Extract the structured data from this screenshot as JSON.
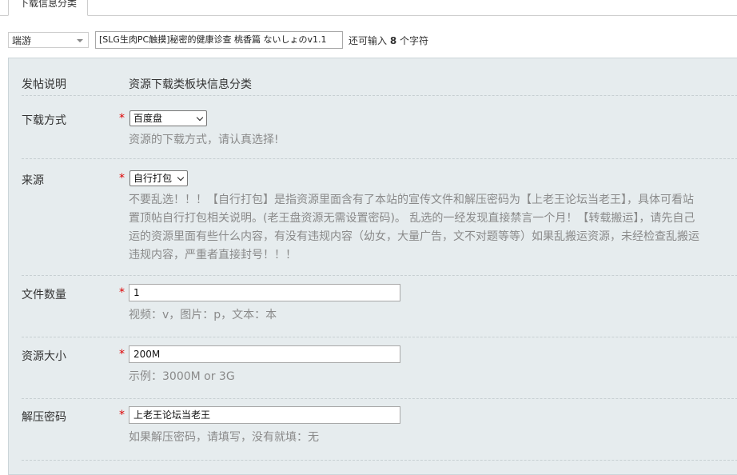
{
  "tabs": [
    {
      "label": "下载信息分类"
    }
  ],
  "subject": {
    "type_select": "端游",
    "title_value": "[SLG生肉PC触摸]秘密的健康诊查 桃香篇 ないしょのv1.1",
    "remaining_prefix": "还可输入",
    "remaining_count": "8",
    "remaining_suffix": "个字符"
  },
  "form": {
    "intro": {
      "label": "发帖说明",
      "value": "资源下载类板块信息分类"
    },
    "download_method": {
      "label": "下载方式",
      "required": "*",
      "selected": "百度盘",
      "hint": "资源的下载方式，请认真选择!"
    },
    "source": {
      "label": "来源",
      "required": "*",
      "selected": "自行打包",
      "hint_lines": [
        "不要乱选！！！【自行打包】是指资源里面含有了本站的宣传文件和解压密码为【上老王论坛当老王】，具体可看站",
        "置顶帖自行打包相关说明。(老王盘资源无需设置密码)。 乱选的一经发现直接禁言一个月！【转载搬运】，请先自己",
        "运的资源里面有些什么内容，有没有违规内容（幼女，大量广告，文不对题等等）如果乱搬运资源，未经检查乱搬运",
        "违规内容，严重者直接封号！！！"
      ]
    },
    "file_count": {
      "label": "文件数量",
      "required": "*",
      "value": "1",
      "hint": "视频：v，图片：p，文本：本"
    },
    "resource_size": {
      "label": "资源大小",
      "required": "*",
      "value": "200M",
      "hint": "示例：3000M or 3G"
    },
    "unzip_password": {
      "label": "解压密码",
      "required": "*",
      "value": "上老王论坛当老王",
      "hint": "如果解压密码，请填写，没有就填：无"
    }
  }
}
